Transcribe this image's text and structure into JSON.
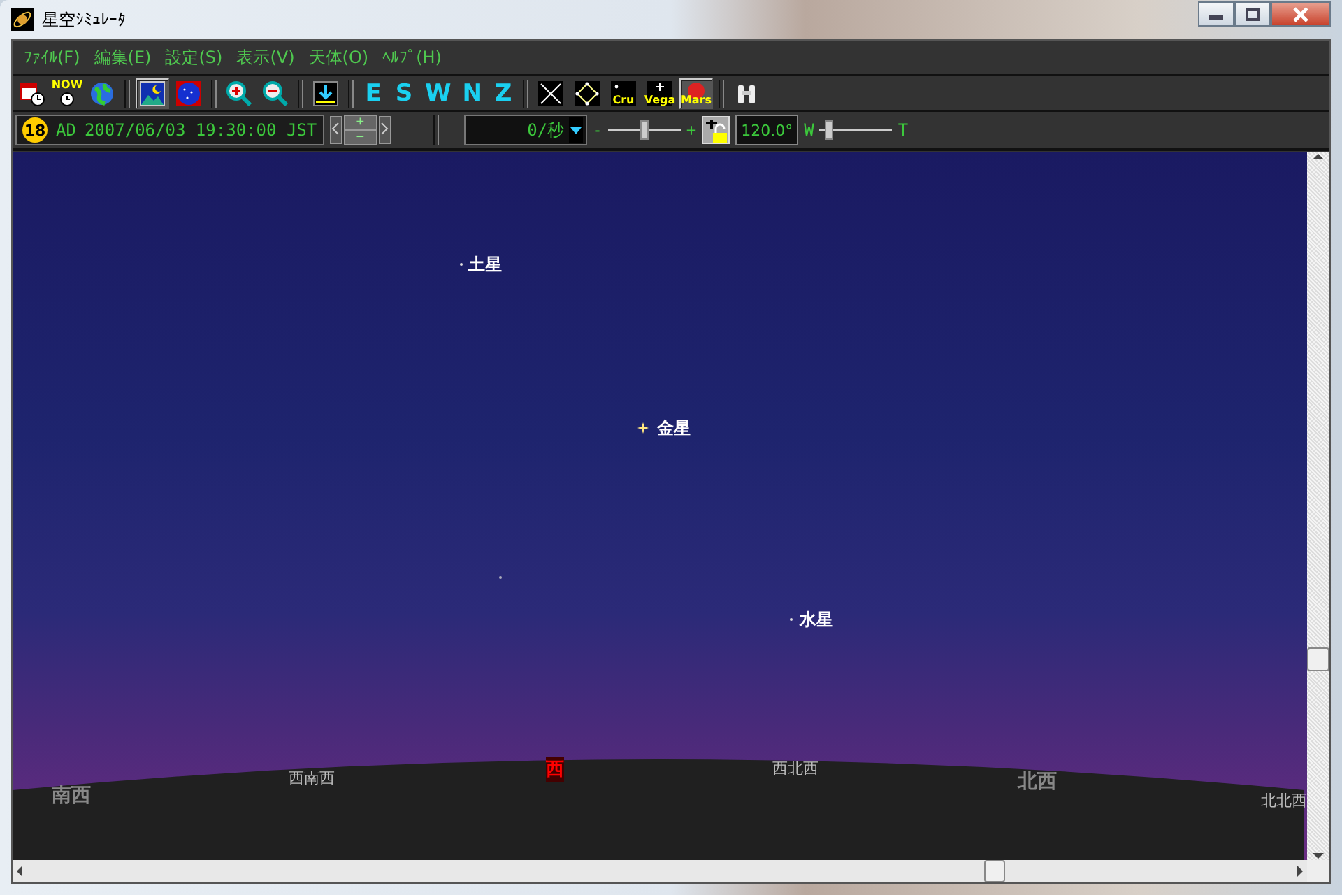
{
  "window": {
    "title": "星空ｼﾐｭﾚｰﾀ"
  },
  "menu": [
    {
      "label": "ﾌｧｲﾙ(F)"
    },
    {
      "label": "編集(E)"
    },
    {
      "label": "設定(S)"
    },
    {
      "label": "表示(V)"
    },
    {
      "label": "天体(O)"
    },
    {
      "label": "ﾍﾙﾌﾟ(H)"
    }
  ],
  "toolbar": [
    {
      "kind": "icon",
      "selected": false
    },
    {
      "kind": "icon",
      "label": "NOW",
      "selected": false
    },
    {
      "kind": "icon",
      "selected": false
    },
    {
      "kind": "separator"
    },
    {
      "kind": "icon",
      "selected": true
    },
    {
      "kind": "icon",
      "selected": false
    },
    {
      "kind": "separator"
    },
    {
      "kind": "icon",
      "selected": false
    },
    {
      "kind": "icon",
      "selected": false
    },
    {
      "kind": "separator"
    },
    {
      "kind": "icon",
      "selected": false
    },
    {
      "kind": "separator"
    },
    {
      "kind": "letter",
      "label": "E",
      "selected": false
    },
    {
      "kind": "letter",
      "label": "S",
      "selected": false
    },
    {
      "kind": "letter",
      "label": "W",
      "selected": false
    },
    {
      "kind": "letter",
      "label": "N",
      "selected": false
    },
    {
      "kind": "letter",
      "label": "Z",
      "selected": false
    },
    {
      "kind": "separator"
    },
    {
      "kind": "icon",
      "selected": false
    },
    {
      "kind": "icon",
      "selected": false
    },
    {
      "kind": "icon",
      "label": "Cru",
      "selected": false
    },
    {
      "kind": "icon",
      "label": "Vega",
      "selected": false
    },
    {
      "kind": "icon",
      "label": "Mars",
      "selected": true
    },
    {
      "kind": "separator"
    },
    {
      "kind": "icon",
      "selected": false
    }
  ],
  "time_bar": {
    "spin_up": "+",
    "spin_down": "−",
    "badge": "18",
    "era": "AD",
    "datetime": "2007/06/03 19:30:00 JST",
    "speed": "0/秒",
    "speed_minus": "-",
    "speed_plus": "+",
    "speed_slider": {
      "level": 0.5
    },
    "field_of_view": "120.0°",
    "zoom_wide": "W",
    "zoom_tele": "T",
    "zoom_slider": {
      "level": 0.12
    }
  },
  "sky": {
    "planets": [
      {
        "name": "土星",
        "kind": "faint"
      },
      {
        "name": "金星",
        "kind": "bright"
      },
      {
        "name": "水星",
        "kind": "faint"
      }
    ],
    "directions": [
      {
        "label": "南西",
        "kind": "major"
      },
      {
        "label": "西南西",
        "kind": "minor"
      },
      {
        "label": "西",
        "kind": "cardinal"
      },
      {
        "label": "西北西",
        "kind": "minor"
      },
      {
        "label": "北西",
        "kind": "major"
      },
      {
        "label": "北北西",
        "kind": "minor"
      }
    ]
  }
}
